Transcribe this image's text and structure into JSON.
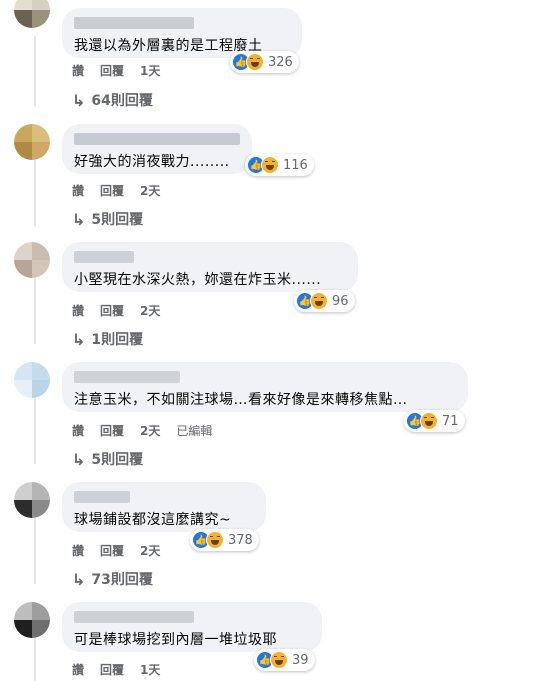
{
  "colors": {
    "accent": "#1877f2",
    "bubble": "#f0f2f5",
    "muted": "#65676b",
    "haha": "#f7b125"
  },
  "comments": [
    {
      "text": "我還以為外層裏的是工程廢土",
      "reactions": "326",
      "like": "讚",
      "reply": "回覆",
      "time": "1天",
      "edited": "",
      "replies_label": "64則回覆",
      "icons": [
        "like-icon",
        "haha-icon"
      ]
    },
    {
      "text": "好強大的消夜戰力........",
      "reactions": "116",
      "like": "讚",
      "reply": "回覆",
      "time": "2天",
      "edited": "",
      "replies_label": "5則回覆",
      "icons": [
        "like-icon",
        "haha-icon"
      ]
    },
    {
      "text": "小堅現在水深火熱，妳還在炸玉米......",
      "reactions": "96",
      "like": "讚",
      "reply": "回覆",
      "time": "2天",
      "edited": "",
      "replies_label": "1則回覆",
      "icons": [
        "like-icon",
        "haha-icon"
      ]
    },
    {
      "text": "注意玉米，不如關注球場…看來好像是來轉移焦點…",
      "reactions": "71",
      "like": "讚",
      "reply": "回覆",
      "time": "2天",
      "edited": "已編輯",
      "replies_label": "5則回覆",
      "icons": [
        "like-icon",
        "haha-icon"
      ]
    },
    {
      "text": "球場鋪設都沒這麼講究~",
      "reactions": "378",
      "like": "讚",
      "reply": "回覆",
      "time": "2天",
      "edited": "",
      "replies_label": "73則回覆",
      "icons": [
        "like-icon",
        "haha-icon"
      ]
    },
    {
      "text": "可是棒球場挖到內層一堆垃圾耶",
      "reactions": "39",
      "like": "讚",
      "reply": "回覆",
      "time": "1天",
      "edited": "",
      "replies_label": "",
      "icons": [
        "like-icon",
        "haha-icon"
      ]
    }
  ]
}
